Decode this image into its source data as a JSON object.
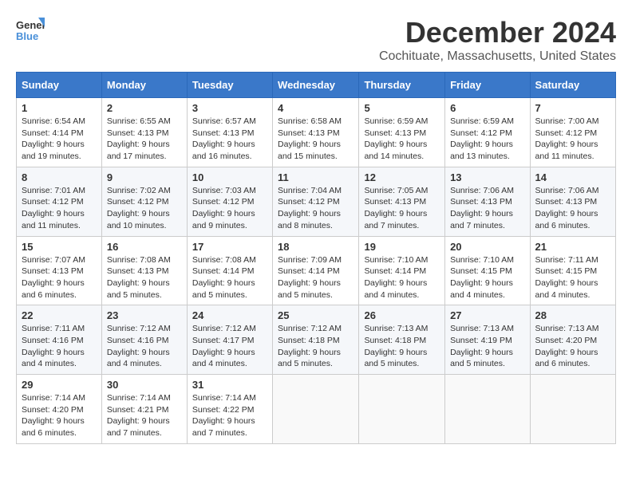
{
  "logo": {
    "general": "General",
    "blue": "Blue"
  },
  "title": {
    "month": "December 2024",
    "location": "Cochituate, Massachusetts, United States"
  },
  "days_of_week": [
    "Sunday",
    "Monday",
    "Tuesday",
    "Wednesday",
    "Thursday",
    "Friday",
    "Saturday"
  ],
  "weeks": [
    [
      {
        "day": "1",
        "sunrise": "6:54 AM",
        "sunset": "4:14 PM",
        "daylight": "9 hours and 19 minutes"
      },
      {
        "day": "2",
        "sunrise": "6:55 AM",
        "sunset": "4:13 PM",
        "daylight": "9 hours and 17 minutes"
      },
      {
        "day": "3",
        "sunrise": "6:57 AM",
        "sunset": "4:13 PM",
        "daylight": "9 hours and 16 minutes"
      },
      {
        "day": "4",
        "sunrise": "6:58 AM",
        "sunset": "4:13 PM",
        "daylight": "9 hours and 15 minutes"
      },
      {
        "day": "5",
        "sunrise": "6:59 AM",
        "sunset": "4:13 PM",
        "daylight": "9 hours and 14 minutes"
      },
      {
        "day": "6",
        "sunrise": "6:59 AM",
        "sunset": "4:12 PM",
        "daylight": "9 hours and 13 minutes"
      },
      {
        "day": "7",
        "sunrise": "7:00 AM",
        "sunset": "4:12 PM",
        "daylight": "9 hours and 11 minutes"
      }
    ],
    [
      {
        "day": "8",
        "sunrise": "7:01 AM",
        "sunset": "4:12 PM",
        "daylight": "9 hours and 11 minutes"
      },
      {
        "day": "9",
        "sunrise": "7:02 AM",
        "sunset": "4:12 PM",
        "daylight": "9 hours and 10 minutes"
      },
      {
        "day": "10",
        "sunrise": "7:03 AM",
        "sunset": "4:12 PM",
        "daylight": "9 hours and 9 minutes"
      },
      {
        "day": "11",
        "sunrise": "7:04 AM",
        "sunset": "4:12 PM",
        "daylight": "9 hours and 8 minutes"
      },
      {
        "day": "12",
        "sunrise": "7:05 AM",
        "sunset": "4:13 PM",
        "daylight": "9 hours and 7 minutes"
      },
      {
        "day": "13",
        "sunrise": "7:06 AM",
        "sunset": "4:13 PM",
        "daylight": "9 hours and 7 minutes"
      },
      {
        "day": "14",
        "sunrise": "7:06 AM",
        "sunset": "4:13 PM",
        "daylight": "9 hours and 6 minutes"
      }
    ],
    [
      {
        "day": "15",
        "sunrise": "7:07 AM",
        "sunset": "4:13 PM",
        "daylight": "9 hours and 6 minutes"
      },
      {
        "day": "16",
        "sunrise": "7:08 AM",
        "sunset": "4:13 PM",
        "daylight": "9 hours and 5 minutes"
      },
      {
        "day": "17",
        "sunrise": "7:08 AM",
        "sunset": "4:14 PM",
        "daylight": "9 hours and 5 minutes"
      },
      {
        "day": "18",
        "sunrise": "7:09 AM",
        "sunset": "4:14 PM",
        "daylight": "9 hours and 5 minutes"
      },
      {
        "day": "19",
        "sunrise": "7:10 AM",
        "sunset": "4:14 PM",
        "daylight": "9 hours and 4 minutes"
      },
      {
        "day": "20",
        "sunrise": "7:10 AM",
        "sunset": "4:15 PM",
        "daylight": "9 hours and 4 minutes"
      },
      {
        "day": "21",
        "sunrise": "7:11 AM",
        "sunset": "4:15 PM",
        "daylight": "9 hours and 4 minutes"
      }
    ],
    [
      {
        "day": "22",
        "sunrise": "7:11 AM",
        "sunset": "4:16 PM",
        "daylight": "9 hours and 4 minutes"
      },
      {
        "day": "23",
        "sunrise": "7:12 AM",
        "sunset": "4:16 PM",
        "daylight": "9 hours and 4 minutes"
      },
      {
        "day": "24",
        "sunrise": "7:12 AM",
        "sunset": "4:17 PM",
        "daylight": "9 hours and 4 minutes"
      },
      {
        "day": "25",
        "sunrise": "7:12 AM",
        "sunset": "4:18 PM",
        "daylight": "9 hours and 5 minutes"
      },
      {
        "day": "26",
        "sunrise": "7:13 AM",
        "sunset": "4:18 PM",
        "daylight": "9 hours and 5 minutes"
      },
      {
        "day": "27",
        "sunrise": "7:13 AM",
        "sunset": "4:19 PM",
        "daylight": "9 hours and 5 minutes"
      },
      {
        "day": "28",
        "sunrise": "7:13 AM",
        "sunset": "4:20 PM",
        "daylight": "9 hours and 6 minutes"
      }
    ],
    [
      {
        "day": "29",
        "sunrise": "7:14 AM",
        "sunset": "4:20 PM",
        "daylight": "9 hours and 6 minutes"
      },
      {
        "day": "30",
        "sunrise": "7:14 AM",
        "sunset": "4:21 PM",
        "daylight": "9 hours and 7 minutes"
      },
      {
        "day": "31",
        "sunrise": "7:14 AM",
        "sunset": "4:22 PM",
        "daylight": "9 hours and 7 minutes"
      },
      null,
      null,
      null,
      null
    ]
  ]
}
